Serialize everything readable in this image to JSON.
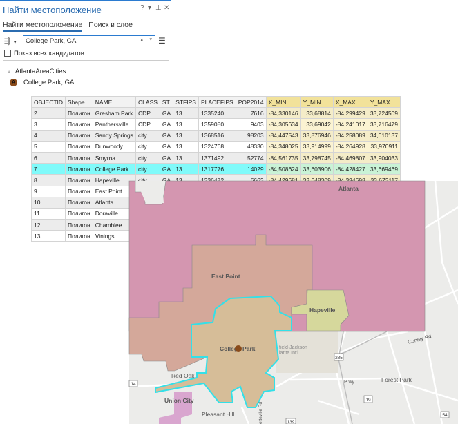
{
  "panel": {
    "title": "Найти местоположение",
    "controls": [
      "?",
      "▾",
      "⊥",
      "✕"
    ],
    "tabs": [
      {
        "label": "Найти местоположение",
        "active": true
      },
      {
        "label": "Поиск в слое",
        "active": false
      }
    ],
    "search": {
      "value": "College Park, GA",
      "clear": "×",
      "dropdown": "▾"
    },
    "show_all_label": "Показ всех кандидатов",
    "show_all_checked": false,
    "group": "AtlantaAreaCities",
    "result": {
      "marker": "A",
      "label": "College Park, GA"
    }
  },
  "table": {
    "columns": [
      "OBJECTID",
      "Shape",
      "NAME",
      "CLASS",
      "ST",
      "STFIPS",
      "PLACEFIPS",
      "POP2014",
      "X_MIN",
      "Y_MIN",
      "X_MAX",
      "Y_MAX"
    ],
    "selected_objectid": "7",
    "rows": [
      [
        "2",
        "Полигон",
        "Gresham Park",
        "CDP",
        "GA",
        "13",
        "1335240",
        "7616",
        "-84,330146",
        "33,68814",
        "-84,299429",
        "33,724509"
      ],
      [
        "3",
        "Полигон",
        "Panthersville",
        "CDP",
        "GA",
        "13",
        "1359080",
        "9403",
        "-84,305634",
        "33,69042",
        "-84,241017",
        "33,716479"
      ],
      [
        "4",
        "Полигон",
        "Sandy Springs",
        "city",
        "GA",
        "13",
        "1368516",
        "98203",
        "-84,447543",
        "33,876946",
        "-84,258089",
        "34,010137"
      ],
      [
        "5",
        "Полигон",
        "Dunwoody",
        "city",
        "GA",
        "13",
        "1324768",
        "48330",
        "-84,348025",
        "33,914999",
        "-84,264928",
        "33,970911"
      ],
      [
        "6",
        "Полигон",
        "Smyrna",
        "city",
        "GA",
        "13",
        "1371492",
        "52774",
        "-84,561735",
        "33,798745",
        "-84,469807",
        "33,904033"
      ],
      [
        "7",
        "Полигон",
        "College Park",
        "city",
        "GA",
        "13",
        "1317776",
        "14029",
        "-84,508624",
        "33,603906",
        "-84,428427",
        "33,669469"
      ],
      [
        "8",
        "Полигон",
        "Hapeville",
        "city",
        "GA",
        "13",
        "1336472",
        "6663",
        "-84,429681",
        "33,648309",
        "-84,394698",
        "33,673117"
      ],
      [
        "9",
        "Полигон",
        "East Point",
        "",
        "",
        "",
        "",
        "",
        "",
        "",
        "",
        ""
      ],
      [
        "10",
        "Полигон",
        "Atlanta",
        "",
        "",
        "",
        "",
        "",
        "",
        "",
        "",
        ""
      ],
      [
        "11",
        "Полигон",
        "Doraville",
        "",
        "",
        "",
        "",
        "",
        "",
        "",
        "",
        ""
      ],
      [
        "12",
        "Полигон",
        "Chamblee",
        "",
        "",
        "",
        "",
        "",
        "",
        "",
        "",
        ""
      ],
      [
        "13",
        "Полигон",
        "Vinings",
        "",
        "",
        "",
        "",
        "",
        "",
        "",
        "",
        ""
      ]
    ]
  },
  "map": {
    "labels": {
      "atlanta": "Atlanta",
      "east_point": "East Point",
      "hapeville": "Hapeville",
      "college_park": "College Park",
      "red_oak": "Red Oak",
      "union_city": "Union City",
      "pleasant_hill": "Pleasant Hill",
      "forest_park": "Forest Park",
      "conley_rd": "Conley Rd",
      "airport1": "field-Jackson",
      "airport2": "lanta Int'l",
      "fayetteville": "etteville Rd",
      "pwy": "P wy"
    },
    "shields": [
      "285",
      "19",
      "14",
      "54",
      "139"
    ],
    "colors": {
      "atlanta": "#d496b0",
      "east_point": "#d4a89a",
      "hapeville": "#d6d89c",
      "college_park": "#d6bd98",
      "selection": "#33e0e8",
      "union_city": "#d9a6cf",
      "basemap": "#ececea"
    }
  }
}
